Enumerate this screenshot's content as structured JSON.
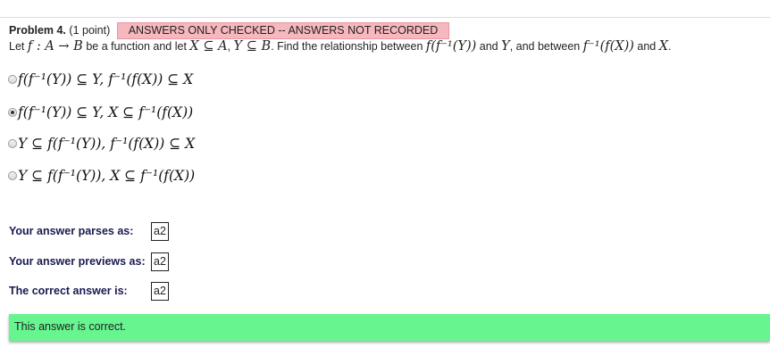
{
  "problem": {
    "label": "Problem 4.",
    "points": "(1 point)",
    "notice": "ANSWERS ONLY CHECKED -- ANSWERS NOT RECORDED"
  },
  "question": {
    "p1": "Let",
    "p2": "be a function and let",
    "p3": ",",
    "p4": ". Find the relationship between",
    "p5": "and",
    "p6": ", and between",
    "p7": "and",
    "p8": ".",
    "m_func": "f : A → B",
    "m_x_sub": "X ⊆ A",
    "m_y_sub": "Y ⊆ B",
    "m_expr1": "f(f⁻¹(Y))",
    "m_y": "Y",
    "m_expr2": "f⁻¹(f(X))",
    "m_x": "X"
  },
  "options": [
    {
      "text": "f(f⁻¹(Y)) ⊆ Y, f⁻¹(f(X)) ⊆ X",
      "selected": false
    },
    {
      "text": "f(f⁻¹(Y)) ⊆ Y, X ⊆ f⁻¹(f(X))",
      "selected": true
    },
    {
      "text": "Y ⊆ f(f⁻¹(Y)), f⁻¹(f(X)) ⊆ X",
      "selected": false
    },
    {
      "text": "Y ⊆ f(f⁻¹(Y)), X ⊆ f⁻¹(f(X))",
      "selected": false
    }
  ],
  "answers": {
    "parses_label": "Your answer parses as:",
    "parses_value": "a2",
    "previews_label": "Your answer previews as:",
    "previews_value": "a2",
    "correct_label": "The correct answer is:",
    "correct_value": "a2"
  },
  "result": {
    "message": "This answer is correct.",
    "color": "#66f58f"
  },
  "colors": {
    "notice_bg": "#f6b8be",
    "label_text": "#1a1a50"
  }
}
